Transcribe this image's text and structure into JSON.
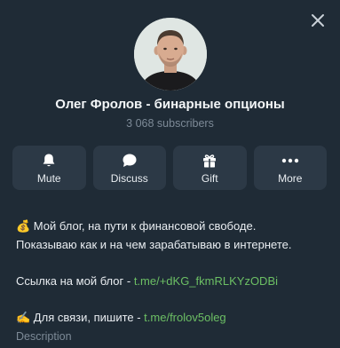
{
  "channel": {
    "name": "Олег Фролов - бинарные опционы",
    "subscribers": "3 068 subscribers"
  },
  "actions": [
    {
      "label": "Mute",
      "icon": "bell-icon"
    },
    {
      "label": "Discuss",
      "icon": "chat-bubble-icon"
    },
    {
      "label": "Gift",
      "icon": "gift-icon"
    },
    {
      "label": "More",
      "icon": "more-dots-icon"
    }
  ],
  "description": {
    "line1_emoji": "💰",
    "line1_text": " Мой блог, на пути к финансовой свободе.",
    "line2": "Показываю как и на чем зарабатываю в интернете.",
    "blog_prefix": "Ссылка на мой блог - ",
    "blog_link": "t.me/+dKG_fkmRLKYzODBi",
    "contact_emoji": "✍️",
    "contact_prefix": " Для связи, пишите - ",
    "contact_link": "t.me/frolov5oleg",
    "caption": "Description"
  },
  "colors": {
    "background": "#1f2b36",
    "button_bg": "#2c3946",
    "link": "#6cbf64",
    "muted": "#7d8a97"
  }
}
